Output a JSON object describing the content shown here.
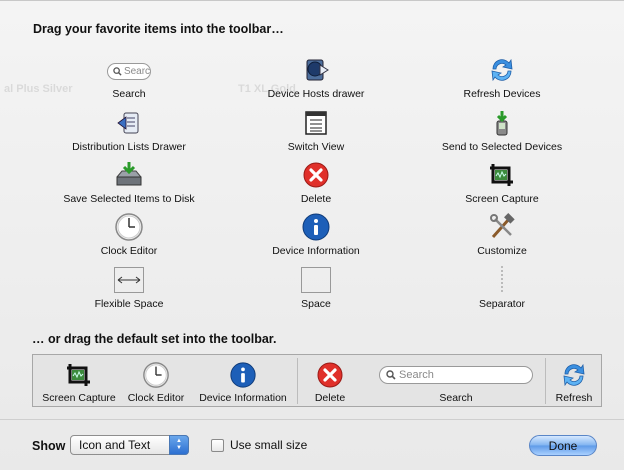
{
  "header": {
    "title": "Drag your favorite items into the toolbar…"
  },
  "background_ghost": [
    "al Plus Silver",
    "T1 XL Gold"
  ],
  "items": [
    {
      "label": "Search",
      "icon": "search-field-icon",
      "search_placeholder": "Searc"
    },
    {
      "label": "Device Hosts drawer",
      "icon": "device-hosts-drawer-icon"
    },
    {
      "label": "Refresh Devices",
      "icon": "refresh-icon"
    },
    {
      "label": "Distribution Lists Drawer",
      "icon": "distribution-lists-drawer-icon"
    },
    {
      "label": "Switch View",
      "icon": "switch-view-icon"
    },
    {
      "label": "Send to Selected Devices",
      "icon": "send-to-devices-icon"
    },
    {
      "label": "Save Selected Items to Disk",
      "icon": "save-to-disk-icon"
    },
    {
      "label": "Delete",
      "icon": "delete-icon"
    },
    {
      "label": "Screen Capture",
      "icon": "screen-capture-icon"
    },
    {
      "label": "Clock Editor",
      "icon": "clock-icon"
    },
    {
      "label": "Device Information",
      "icon": "info-icon"
    },
    {
      "label": "Customize",
      "icon": "customize-tools-icon"
    },
    {
      "label": "Flexible Space",
      "icon": "flexible-space-icon"
    },
    {
      "label": "Space",
      "icon": "space-icon"
    },
    {
      "label": "Separator",
      "icon": "separator-icon"
    }
  ],
  "default_set": {
    "title": "… or drag the default set into the toolbar.",
    "items": [
      {
        "label": "Screen Capture",
        "icon": "screen-capture-icon"
      },
      {
        "label": "Clock Editor",
        "icon": "clock-icon"
      },
      {
        "label": "Device Information",
        "icon": "info-icon"
      },
      {
        "label": "Delete",
        "icon": "delete-icon"
      },
      {
        "label": "Search",
        "icon": "search-field-icon",
        "search_placeholder": "Search"
      },
      {
        "label": "Refresh",
        "icon": "refresh-icon"
      }
    ]
  },
  "footer": {
    "show_label": "Show",
    "show_value": "Icon and Text",
    "small_size_label": "Use small size",
    "small_size_checked": false,
    "done_label": "Done"
  },
  "colors": {
    "accent": "#3b82e0",
    "delete": "#e0302a",
    "info": "#1d5fb8"
  }
}
